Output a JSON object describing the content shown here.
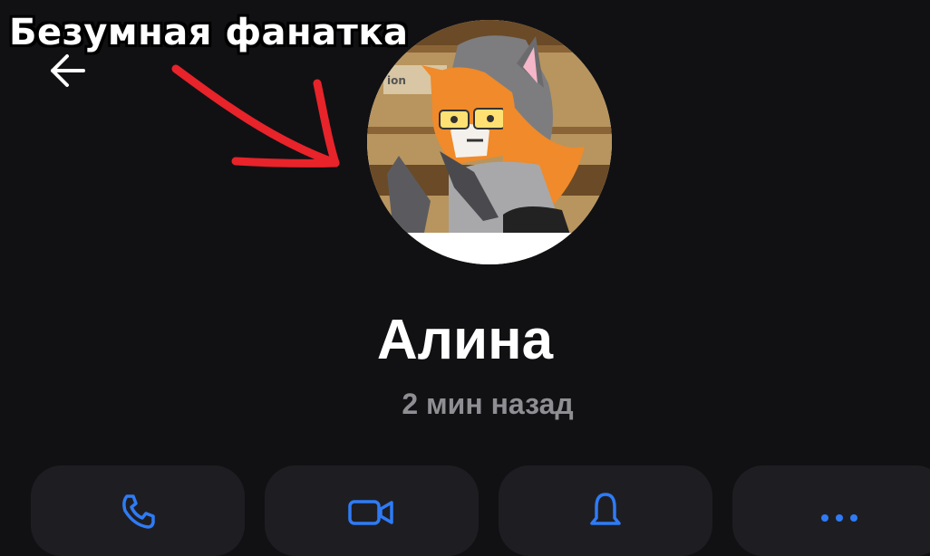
{
  "caption": "Безумная фанатка",
  "profile": {
    "name": "Алина",
    "last_seen": "2 мин назад"
  },
  "avatar_sign_text": "ion",
  "icons": {
    "back": "arrow-left-icon",
    "call": "phone-icon",
    "video": "video-camera-icon",
    "mute": "bell-icon",
    "more": "more-dots-icon"
  },
  "colors": {
    "background": "#111114",
    "card": "#1e1e22",
    "accent": "#2f7bf6",
    "annotation": "#e8232a",
    "muted_text": "#8e8e93"
  }
}
